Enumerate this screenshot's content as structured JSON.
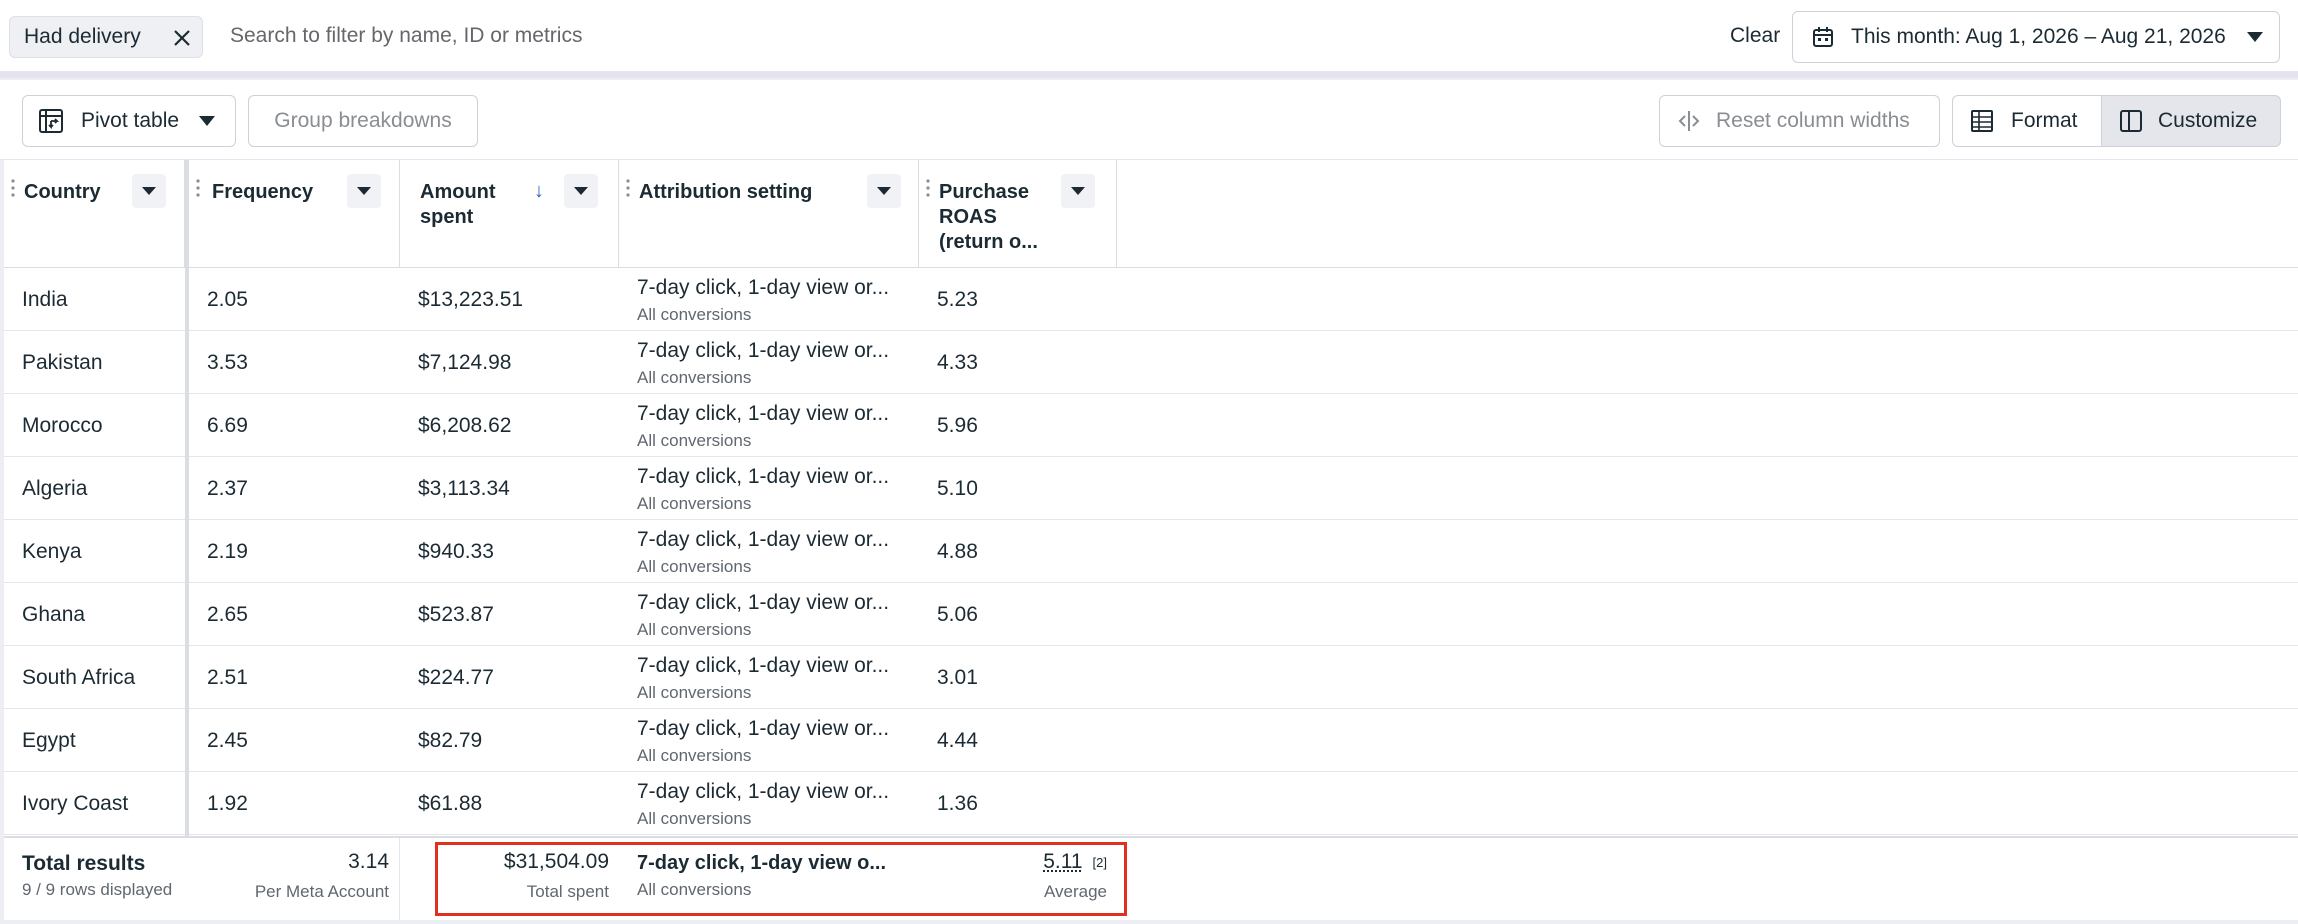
{
  "filter_bar": {
    "chip_label": "Had delivery",
    "search_placeholder": "Search to filter by name, ID or metrics",
    "clear_label": "Clear",
    "date_range_label": "This month: Aug 1, 2026 – Aug 21, 2026"
  },
  "toolbar": {
    "pivot_label": "Pivot table",
    "group_breakdowns_label": "Group breakdowns",
    "reset_widths_label": "Reset column widths",
    "format_label": "Format",
    "customize_label": "Customize"
  },
  "table": {
    "columns": [
      {
        "label": "Country"
      },
      {
        "label": "Frequency"
      },
      {
        "label": "Amount\nspent",
        "sorted": "descending"
      },
      {
        "label": "Attribution setting"
      },
      {
        "label": "Purchase\nROAS\n(return o..."
      }
    ],
    "rows": [
      {
        "country": "India",
        "frequency": "2.05",
        "amount": "$13,223.51",
        "attribution": "7-day click, 1-day view or...",
        "attribution_sub": "All conversions",
        "roas": "5.23"
      },
      {
        "country": "Pakistan",
        "frequency": "3.53",
        "amount": "$7,124.98",
        "attribution": "7-day click, 1-day view or...",
        "attribution_sub": "All conversions",
        "roas": "4.33"
      },
      {
        "country": "Morocco",
        "frequency": "6.69",
        "amount": "$6,208.62",
        "attribution": "7-day click, 1-day view or...",
        "attribution_sub": "All conversions",
        "roas": "5.96"
      },
      {
        "country": "Algeria",
        "frequency": "2.37",
        "amount": "$3,113.34",
        "attribution": "7-day click, 1-day view or...",
        "attribution_sub": "All conversions",
        "roas": "5.10"
      },
      {
        "country": "Kenya",
        "frequency": "2.19",
        "amount": "$940.33",
        "attribution": "7-day click, 1-day view or...",
        "attribution_sub": "All conversions",
        "roas": "4.88"
      },
      {
        "country": "Ghana",
        "frequency": "2.65",
        "amount": "$523.87",
        "attribution": "7-day click, 1-day view or...",
        "attribution_sub": "All conversions",
        "roas": "5.06"
      },
      {
        "country": "South Africa",
        "frequency": "2.51",
        "amount": "$224.77",
        "attribution": "7-day click, 1-day view or...",
        "attribution_sub": "All conversions",
        "roas": "3.01"
      },
      {
        "country": "Egypt",
        "frequency": "2.45",
        "amount": "$82.79",
        "attribution": "7-day click, 1-day view or...",
        "attribution_sub": "All conversions",
        "roas": "4.44"
      },
      {
        "country": "Ivory Coast",
        "frequency": "1.92",
        "amount": "$61.88",
        "attribution": "7-day click, 1-day view or...",
        "attribution_sub": "All conversions",
        "roas": "1.36"
      }
    ],
    "totals": {
      "title": "Total results",
      "rows_displayed": "9 / 9 rows displayed",
      "frequency_value": "3.14",
      "frequency_label": "Per Meta Account",
      "amount_value": "$31,504.09",
      "amount_label": "Total spent",
      "attribution_value": "7-day click, 1-day view o...",
      "attribution_sub": "All conversions",
      "roas_value": "5.11",
      "roas_footnote": "[2]",
      "roas_label": "Average"
    }
  },
  "colors": {
    "highlight_border": "#e0301e",
    "sort_arrow": "#2d63c8"
  }
}
